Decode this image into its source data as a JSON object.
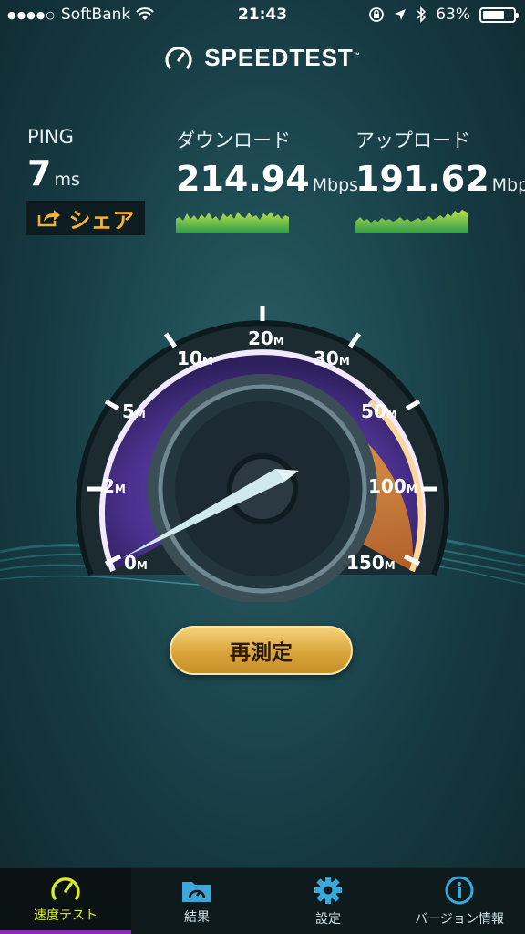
{
  "status_bar": {
    "signal": "●●●●○",
    "carrier": "SoftBank",
    "time": "21:43",
    "battery": "63%"
  },
  "header": {
    "title": "SPEEDTEST",
    "tm": "™"
  },
  "ping": {
    "label": "PING",
    "value": "7",
    "unit": "ms"
  },
  "download": {
    "label": "ダウンロード",
    "value": "214.94",
    "unit": "Mbps"
  },
  "upload": {
    "label": "アップロード",
    "value": "191.62",
    "unit": "Mbps"
  },
  "share": {
    "label": "シェア"
  },
  "gauge": {
    "ticks": [
      "0",
      "2",
      "5",
      "10",
      "20",
      "30",
      "50",
      "100",
      "150"
    ],
    "tick_unit": "M",
    "needle_value": "0"
  },
  "retest": {
    "label": "再測定"
  },
  "tabs": [
    {
      "label": "速度テスト",
      "icon": "speedometer-icon",
      "active": true
    },
    {
      "label": "結果",
      "icon": "folder-icon",
      "active": false
    },
    {
      "label": "設定",
      "icon": "gear-icon",
      "active": false
    },
    {
      "label": "バージョン情報",
      "icon": "info-icon",
      "active": false
    }
  ],
  "colors": {
    "accent_gold": "#f2b236",
    "active_tab": "#d8e92b",
    "gauge_purple": "#5b3fa8",
    "gauge_orange": "#e98a25"
  }
}
